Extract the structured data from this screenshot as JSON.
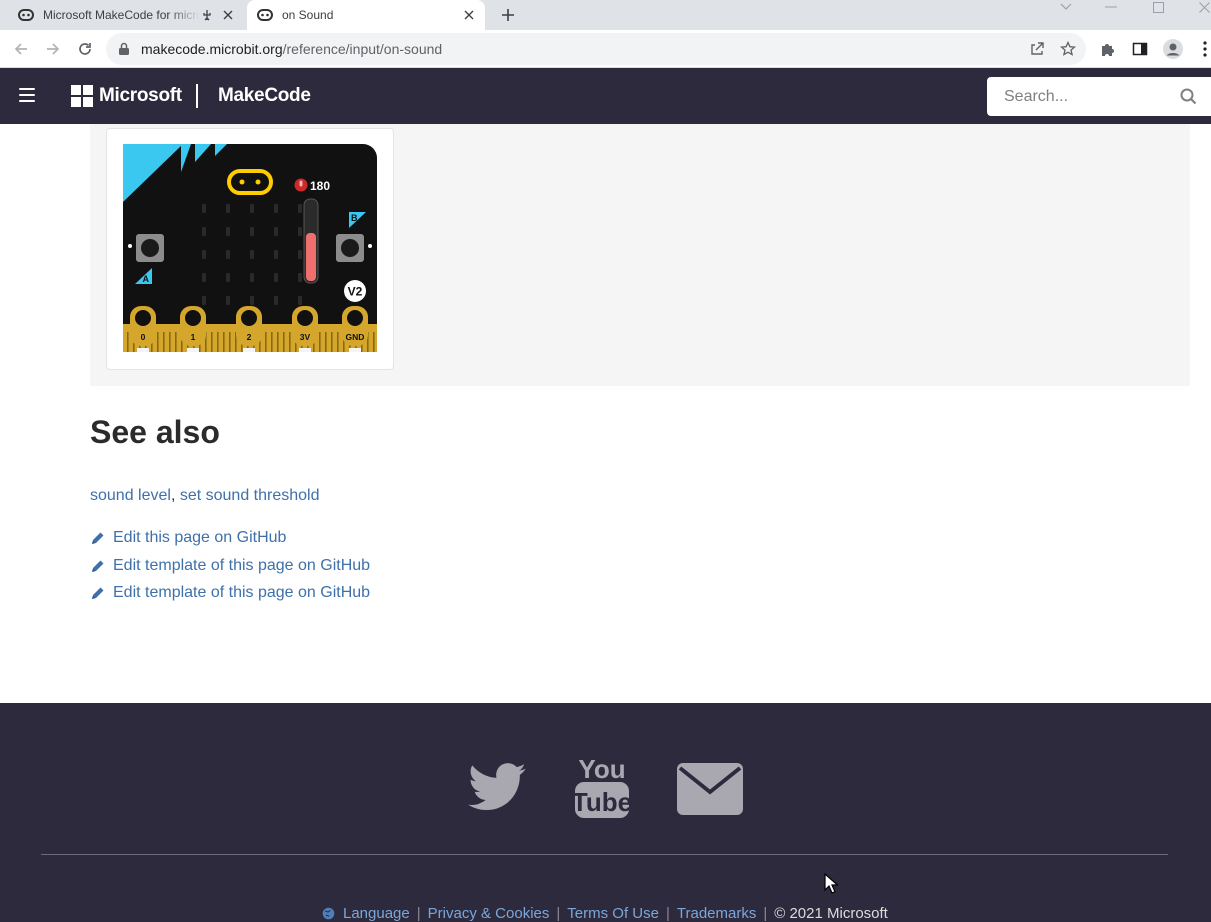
{
  "browser": {
    "tabs": [
      {
        "title": "Microsoft MakeCode for micro:bit",
        "active": false,
        "audio": true
      },
      {
        "title": "on Sound",
        "active": true,
        "audio": false
      }
    ],
    "url": {
      "host": "makecode.microbit.org",
      "path": "/reference/input/on-sound"
    }
  },
  "header": {
    "brand": "Microsoft",
    "product": "MakeCode",
    "search_placeholder": "Search..."
  },
  "simulator": {
    "sound_level": "180",
    "sound_meter_fill_fraction": 0.6,
    "button_a": "A",
    "button_b": "B",
    "version_badge": "V2",
    "pins": [
      "0",
      "1",
      "2",
      "3V",
      "GND"
    ]
  },
  "see_also": {
    "heading": "See also",
    "links": [
      "sound level",
      "set sound threshold"
    ],
    "separator": ", "
  },
  "edit_links": [
    "Edit this page on GitHub",
    "Edit template of this page on GitHub",
    "Edit template of this page on GitHub"
  ],
  "footer": {
    "social": [
      "twitter-icon",
      "youtube-icon",
      "email-icon"
    ],
    "youtube_text_top": "You",
    "youtube_text_bottom": "Tube",
    "links": [
      "Language",
      "Privacy & Cookies",
      "Terms Of Use",
      "Trademarks"
    ],
    "separator": "|",
    "copyright": "© 2021 Microsoft"
  },
  "colors": {
    "header_bg": "#2d2a3d",
    "link": "#3f70aa",
    "footer_link": "#7aa7d9",
    "board_accent": "#3bc8f0",
    "board_gold": "#d4a72c"
  }
}
